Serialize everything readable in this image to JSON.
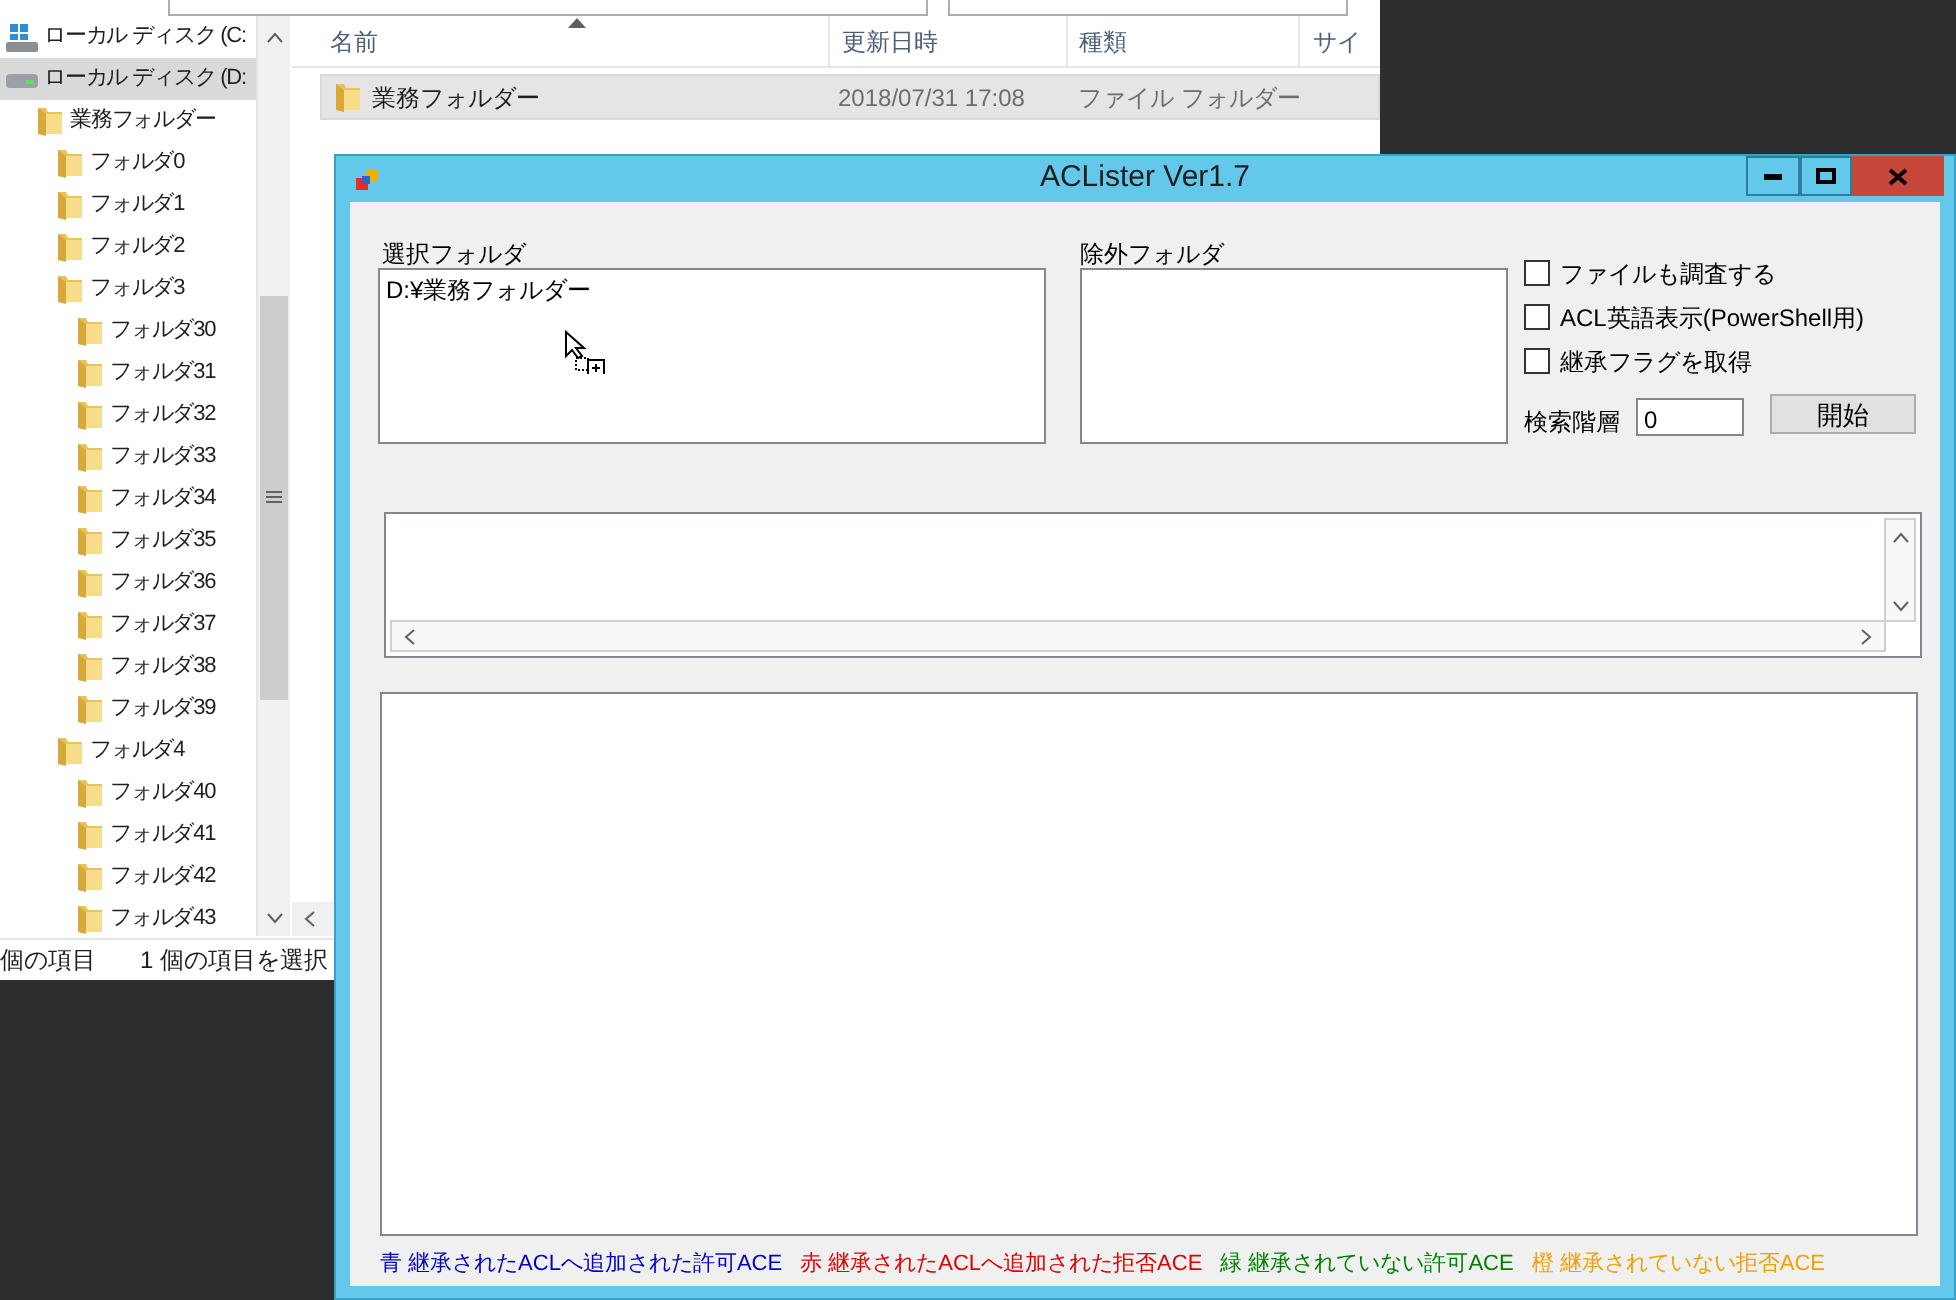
{
  "explorer": {
    "tree": [
      {
        "label": "ローカル ディスク (C:",
        "kind": "drive-c",
        "selected": false
      },
      {
        "label": "ローカル ディスク (D:",
        "kind": "drive-d",
        "selected": true,
        "children": [
          {
            "label": "業務フォルダー",
            "kind": "folder",
            "selected": false,
            "children": [
              {
                "label": "フォルダ0",
                "kind": "folder",
                "selected": false
              },
              {
                "label": "フォルダ1",
                "kind": "folder",
                "selected": false
              },
              {
                "label": "フォルダ2",
                "kind": "folder",
                "selected": false
              },
              {
                "label": "フォルダ3",
                "kind": "folder",
                "selected": false,
                "children": [
                  {
                    "label": "フォルダ30",
                    "kind": "folder",
                    "selected": false
                  },
                  {
                    "label": "フォルダ31",
                    "kind": "folder",
                    "selected": false
                  },
                  {
                    "label": "フォルダ32",
                    "kind": "folder",
                    "selected": false
                  },
                  {
                    "label": "フォルダ33",
                    "kind": "folder",
                    "selected": false
                  },
                  {
                    "label": "フォルダ34",
                    "kind": "folder",
                    "selected": false
                  },
                  {
                    "label": "フォルダ35",
                    "kind": "folder",
                    "selected": false
                  },
                  {
                    "label": "フォルダ36",
                    "kind": "folder",
                    "selected": false
                  },
                  {
                    "label": "フォルダ37",
                    "kind": "folder",
                    "selected": false
                  },
                  {
                    "label": "フォルダ38",
                    "kind": "folder",
                    "selected": false
                  },
                  {
                    "label": "フォルダ39",
                    "kind": "folder",
                    "selected": false
                  }
                ]
              },
              {
                "label": "フォルダ4",
                "kind": "folder",
                "selected": false,
                "children": [
                  {
                    "label": "フォルダ40",
                    "kind": "folder",
                    "selected": false
                  },
                  {
                    "label": "フォルダ41",
                    "kind": "folder",
                    "selected": false
                  },
                  {
                    "label": "フォルダ42",
                    "kind": "folder",
                    "selected": false
                  },
                  {
                    "label": "フォルダ43",
                    "kind": "folder",
                    "selected": false
                  }
                ]
              }
            ]
          }
        ]
      }
    ],
    "columns": [
      "名前",
      "更新日時",
      "種類",
      "サイ"
    ],
    "rows": [
      {
        "name": "業務フォルダー",
        "modified": "2018/07/31 17:08",
        "type": "ファイル フォルダー",
        "selected": true
      }
    ],
    "status_bar": [
      "個の項目",
      "1 個の項目を選択"
    ]
  },
  "app": {
    "window": {
      "title": "ACLister Ver1.7"
    },
    "selected_folder": {
      "label": "選択フォルダ",
      "value": "D:¥業務フォルダー"
    },
    "excluded_folder": {
      "label": "除外フォルダ"
    },
    "options": [
      {
        "label": "ファイルも調査する",
        "checked": false
      },
      {
        "label": "ACL英語表示(PowerShell用)",
        "checked": false
      },
      {
        "label": "継承フラグを取得",
        "checked": false
      }
    ],
    "depth": {
      "label": "検索階層",
      "value": "0"
    },
    "start_button": "開始",
    "legend": [
      {
        "label": "青 継承されたACLへ追加された許可ACE",
        "color": "#0000c8"
      },
      {
        "label": "赤 継承されたACLへ追加された拒否ACE",
        "color": "#e00000"
      },
      {
        "label": "緑 継承されていない許可ACE",
        "color": "#008000"
      },
      {
        "label": "橙 継承されていない拒否ACE",
        "color": "#f0a000"
      }
    ]
  }
}
